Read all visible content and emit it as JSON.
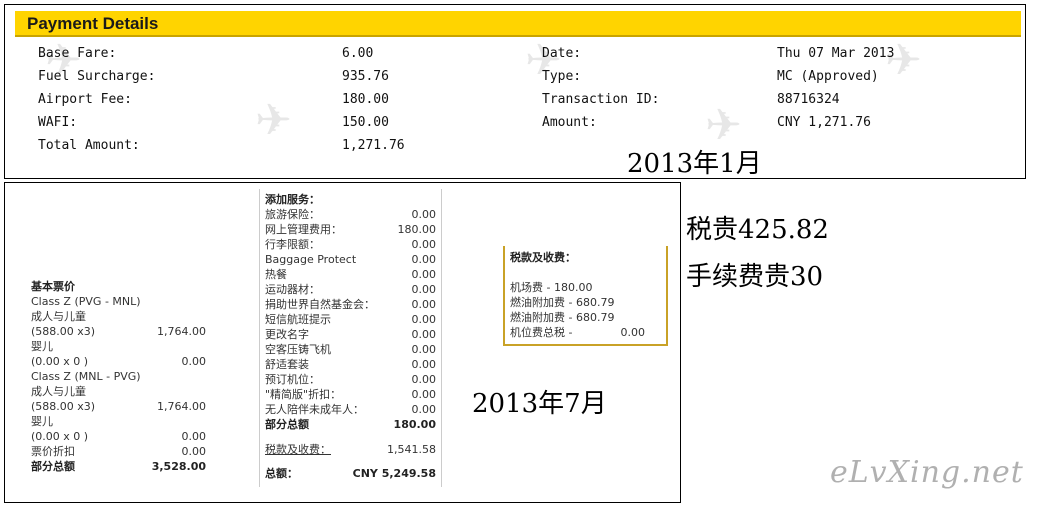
{
  "payment_details": {
    "title": "Payment Details",
    "left": [
      {
        "label": "Base Fare:",
        "value": "6.00"
      },
      {
        "label": "Fuel Surcharge:",
        "value": "935.76"
      },
      {
        "label": "Airport Fee:",
        "value": "180.00"
      },
      {
        "label": "WAFI:",
        "value": "150.00"
      },
      {
        "label": "Total Amount:",
        "value": "1,271.76"
      }
    ],
    "right": [
      {
        "label": "Date:",
        "value": "Thu 07 Mar 2013"
      },
      {
        "label": "Type:",
        "value": "MC (Approved)"
      },
      {
        "label": "Transaction ID:",
        "value": "88716324"
      },
      {
        "label": "Amount:",
        "value": "CNY 1,271.76"
      }
    ],
    "month_note": "2013年1月"
  },
  "notes": {
    "tax": "税贵425.82",
    "fee": "手续费贵30",
    "month_july": "2013年7月"
  },
  "booking": {
    "base_fare": {
      "title": "基本票价",
      "rows": [
        {
          "label": "Class Z (PVG - MNL)",
          "value": ""
        },
        {
          "label": "成人与儿童",
          "value": ""
        },
        {
          "label": " (588.00 x3)",
          "value": "1,764.00"
        },
        {
          "label": "婴儿",
          "value": ""
        },
        {
          "label": " (0.00 x 0 )",
          "value": "0.00"
        },
        {
          "label": "Class Z (MNL - PVG)",
          "value": ""
        },
        {
          "label": "成人与儿童",
          "value": ""
        },
        {
          "label": " (588.00 x3)",
          "value": "1,764.00"
        },
        {
          "label": "婴儿",
          "value": ""
        },
        {
          "label": " (0.00 x 0 )",
          "value": "0.00"
        },
        {
          "label": "票价折扣",
          "value": "0.00"
        }
      ],
      "subtotal_label": "部分总额",
      "subtotal_value": "3,528.00"
    },
    "addons": {
      "title": "添加服务：",
      "rows": [
        {
          "label": "旅游保险：",
          "value": "0.00"
        },
        {
          "label": "网上管理费用：",
          "value": "180.00"
        },
        {
          "label": "行李限额：",
          "value": "0.00"
        },
        {
          "label": "Baggage Protect",
          "value": "0.00"
        },
        {
          "label": "热餐",
          "value": "0.00"
        },
        {
          "label": "运动器材：",
          "value": "0.00"
        },
        {
          "label": "捐助世界自然基金会：",
          "value": "0.00"
        },
        {
          "label": "短信航班提示",
          "value": "0.00"
        },
        {
          "label": "更改名字",
          "value": "0.00"
        },
        {
          "label": "空客压铸飞机",
          "value": "0.00"
        },
        {
          "label": "舒适套装",
          "value": "0.00"
        },
        {
          "label": "预订机位：",
          "value": "0.00"
        },
        {
          "label": "\"精简版\"折扣：",
          "value": "0.00"
        },
        {
          "label": "无人陪伴未成年人：",
          "value": "0.00"
        }
      ],
      "subtotal_label": "部分总额",
      "subtotal_value": "180.00",
      "taxes_label": "税款及收费：",
      "taxes_value": "1,541.58",
      "total_label": "总额：",
      "total_value": "CNY 5,249.58"
    },
    "taxes_box": {
      "title": "税款及收费：",
      "rows": [
        {
          "label": "机场费 - ",
          "value": "180.00"
        },
        {
          "label": "燃油附加费 - ",
          "value": "680.79"
        },
        {
          "label": "燃油附加费 - ",
          "value": "680.79"
        },
        {
          "label": "机位费总税 - ",
          "value": "0.00"
        }
      ]
    }
  },
  "logo": "eLvXing.net",
  "colors": {
    "header_yellow": "#ffd400",
    "box_gold": "#c9a227"
  }
}
